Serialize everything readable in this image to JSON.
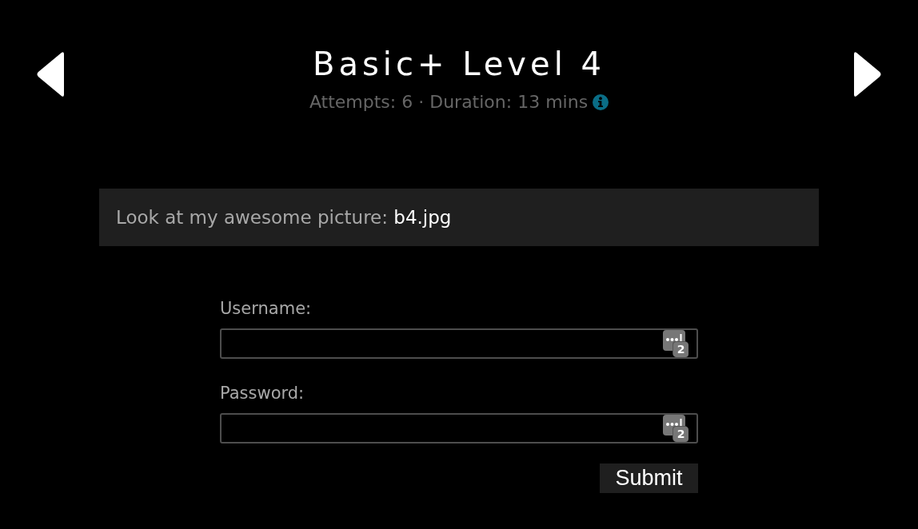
{
  "header": {
    "title": "Basic+ Level 4",
    "subtitle": "Attempts: 6 · Duration: 13 mins"
  },
  "hint": {
    "text": "Look at my awesome picture: **b4.jpg**"
  },
  "form": {
    "fields": [
      {
        "label": "Username:",
        "badge": "2"
      },
      {
        "label": "Password:",
        "badge": "2"
      }
    ],
    "submit": "Submit"
  }
}
